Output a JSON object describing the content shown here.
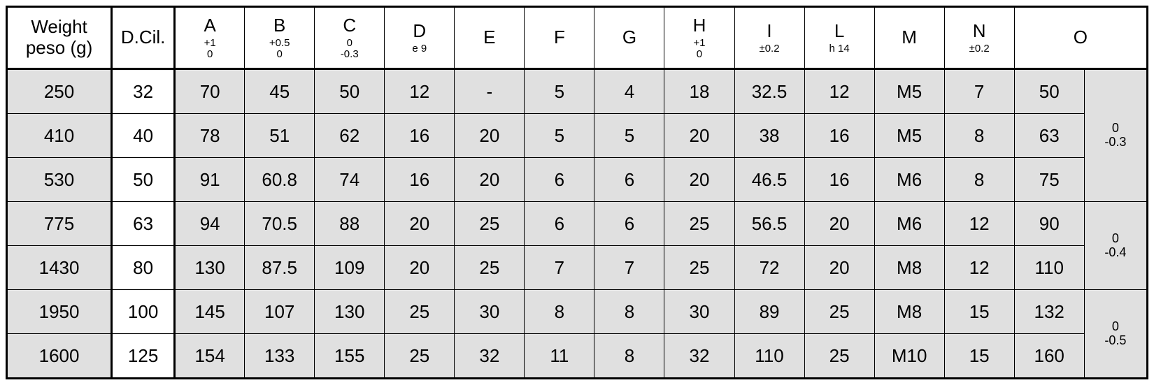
{
  "chart_data": {
    "type": "table",
    "title": "",
    "columns": [
      {
        "key": "weight",
        "label_line1": "Weight",
        "label_line2": "peso (g)",
        "sub1": "",
        "sub2": ""
      },
      {
        "key": "dcil",
        "label_line1": "D.Cil.",
        "label_line2": "",
        "sub1": "",
        "sub2": ""
      },
      {
        "key": "A",
        "label_line1": "A",
        "label_line2": "",
        "sub1": "+1",
        "sub2": "0"
      },
      {
        "key": "B",
        "label_line1": "B",
        "label_line2": "",
        "sub1": "+0.5",
        "sub2": "0"
      },
      {
        "key": "C",
        "label_line1": "C",
        "label_line2": "",
        "sub1": "0",
        "sub2": "-0.3"
      },
      {
        "key": "D",
        "label_line1": "D",
        "label_line2": "",
        "sub1": "e 9",
        "sub2": ""
      },
      {
        "key": "E",
        "label_line1": "E",
        "label_line2": "",
        "sub1": "",
        "sub2": ""
      },
      {
        "key": "F",
        "label_line1": "F",
        "label_line2": "",
        "sub1": "",
        "sub2": ""
      },
      {
        "key": "G",
        "label_line1": "G",
        "label_line2": "",
        "sub1": "",
        "sub2": ""
      },
      {
        "key": "H",
        "label_line1": "H",
        "label_line2": "",
        "sub1": "+1",
        "sub2": "0"
      },
      {
        "key": "I",
        "label_line1": "I",
        "label_line2": "",
        "sub1": "±0.2",
        "sub2": ""
      },
      {
        "key": "L",
        "label_line1": "L",
        "label_line2": "",
        "sub1": "h 14",
        "sub2": ""
      },
      {
        "key": "M",
        "label_line1": "M",
        "label_line2": "",
        "sub1": "",
        "sub2": ""
      },
      {
        "key": "N",
        "label_line1": "N",
        "label_line2": "",
        "sub1": "±0.2",
        "sub2": ""
      },
      {
        "key": "O",
        "label_line1": "O",
        "label_line2": "",
        "sub1": "",
        "sub2": ""
      }
    ],
    "rows": [
      {
        "weight": "250",
        "dcil": "32",
        "A": "70",
        "B": "45",
        "C": "50",
        "D": "12",
        "E": "-",
        "F": "5",
        "G": "4",
        "H": "18",
        "I": "32.5",
        "L": "12",
        "M": "M5",
        "N": "7",
        "O": "50"
      },
      {
        "weight": "410",
        "dcil": "40",
        "A": "78",
        "B": "51",
        "C": "62",
        "D": "16",
        "E": "20",
        "F": "5",
        "G": "5",
        "H": "20",
        "I": "38",
        "L": "16",
        "M": "M5",
        "N": "8",
        "O": "63"
      },
      {
        "weight": "530",
        "dcil": "50",
        "A": "91",
        "B": "60.8",
        "C": "74",
        "D": "16",
        "E": "20",
        "F": "6",
        "G": "6",
        "H": "20",
        "I": "46.5",
        "L": "16",
        "M": "M6",
        "N": "8",
        "O": "75"
      },
      {
        "weight": "775",
        "dcil": "63",
        "A": "94",
        "B": "70.5",
        "C": "88",
        "D": "20",
        "E": "25",
        "F": "6",
        "G": "6",
        "H": "25",
        "I": "56.5",
        "L": "20",
        "M": "M6",
        "N": "12",
        "O": "90"
      },
      {
        "weight": "1430",
        "dcil": "80",
        "A": "130",
        "B": "87.5",
        "C": "109",
        "D": "20",
        "E": "25",
        "F": "7",
        "G": "7",
        "H": "25",
        "I": "72",
        "L": "20",
        "M": "M8",
        "N": "12",
        "O": "110"
      },
      {
        "weight": "1950",
        "dcil": "100",
        "A": "145",
        "B": "107",
        "C": "130",
        "D": "25",
        "E": "30",
        "F": "8",
        "G": "8",
        "H": "30",
        "I": "89",
        "L": "25",
        "M": "M8",
        "N": "15",
        "O": "132"
      },
      {
        "weight": "1600",
        "dcil": "125",
        "A": "154",
        "B": "133",
        "C": "155",
        "D": "25",
        "E": "32",
        "F": "11",
        "G": "8",
        "H": "32",
        "I": "110",
        "L": "25",
        "M": "M10",
        "N": "15",
        "O": "160"
      }
    ],
    "o_tolerances": [
      {
        "upper": "0",
        "lower": "-0.3",
        "rowspan": 3
      },
      {
        "upper": "0",
        "lower": "-0.4",
        "rowspan": 2
      },
      {
        "upper": "0",
        "lower": "-0.5",
        "rowspan": 2
      }
    ]
  }
}
